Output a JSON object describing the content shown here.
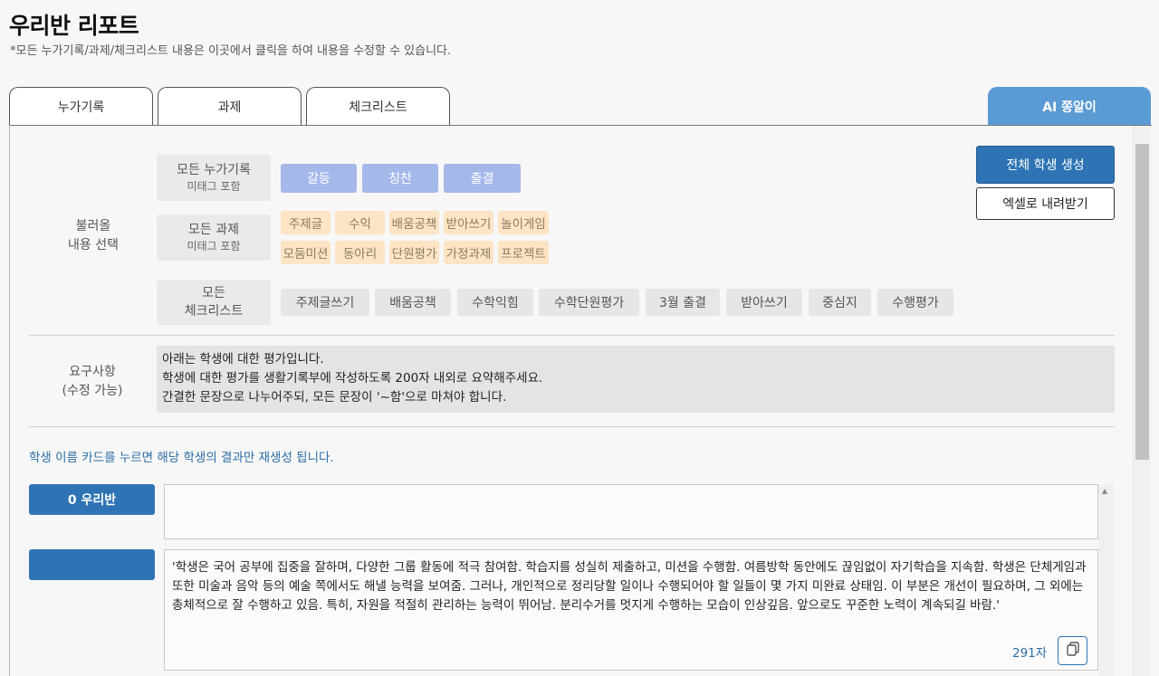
{
  "header": {
    "title": "우리반 리포트",
    "subtitle": "*모든 누가기록/과제/체크리스트 내용은 이곳에서 클릭을 하여 내용을 수정할 수 있습니다."
  },
  "tabs": [
    {
      "label": "누가기록"
    },
    {
      "label": "과제"
    },
    {
      "label": "체크리스트"
    },
    {
      "label": "AI 쫑알이"
    }
  ],
  "load_section": {
    "label_line1": "불러올",
    "label_line2": "내용 선택",
    "records": {
      "main": "모든 누가기록",
      "sub": "미태그 포함"
    },
    "assignments": {
      "main": "모든 과제",
      "sub": "미태그 포함"
    },
    "checklists": {
      "main_line1": "모든",
      "main_line2": "체크리스트"
    },
    "record_tags": [
      "갈등",
      "칭찬",
      "출결"
    ],
    "assignment_tags_row1": [
      "주제글",
      "수익",
      "배움공책",
      "받아쓰기",
      "놀이게임"
    ],
    "assignment_tags_row2": [
      "모둠미션",
      "동아리",
      "단원평가",
      "가정과제",
      "프로젝트"
    ],
    "checklist_tags": [
      "주제글쓰기",
      "배움공책",
      "수학익힘",
      "수학단원평가",
      "3월 출결",
      "받아쓰기",
      "중심지",
      "수행평가"
    ]
  },
  "actions": {
    "generate_all": "전체 학생 생성",
    "download_excel": "엑셀로 내려받기"
  },
  "request_section": {
    "label_line1": "요구사항",
    "label_line2": "(수정 가능)",
    "lines": [
      "아래는 학생에 대한 평가입니다.",
      "학생에 대한 평가를 생활기록부에 작성하도록 200자 내외로 요약해주세요.",
      "간결한 문장으로 나누어주되, 모든 문장이 '~함'으로 마쳐야 합니다."
    ]
  },
  "hint": "학생 이름 카드를 누르면 해당 학생의 결과만 재생성 됩니다.",
  "students": [
    {
      "name": "0 우리반",
      "result": ""
    },
    {
      "name": "",
      "result": "'학생은 국어 공부에 집중을 잘하며, 다양한 그룹 활동에 적극 참여함. 학습지를 성실히 제출하고, 미션을 수행함. 여름방학 동안에도 끊임없이 자기학습을 지속함. 학생은 단체게임과 또한 미술과 음악 등의 예술 쪽에서도 해낼 능력을 보여줌. 그러나, 개인적으로 정리당할 일이나 수행되어야 할 일들이 몇 가지 미완료 상태임. 이 부분은 개선이 필요하며, 그 외에는 총체적으로 잘 수행하고 있음. 특히, 자원을 적절히 관리하는 능력이 뛰어남. 분리수거를 멋지게 수행하는 모습이 인상깊음. 앞으로도 꾸준한 노력이 계속되길 바람.'",
      "char_count": "291자"
    }
  ],
  "colors": {
    "primary": "#2e74b5",
    "ai_tab": "#5b9bd5",
    "record_tag": "#a5b8ea",
    "assignment_tag": "#fde4c4",
    "checklist_tag": "#e6e6e6"
  },
  "icons": {
    "copy": "copy-icon",
    "scroll_up": "chevron-up-icon"
  }
}
